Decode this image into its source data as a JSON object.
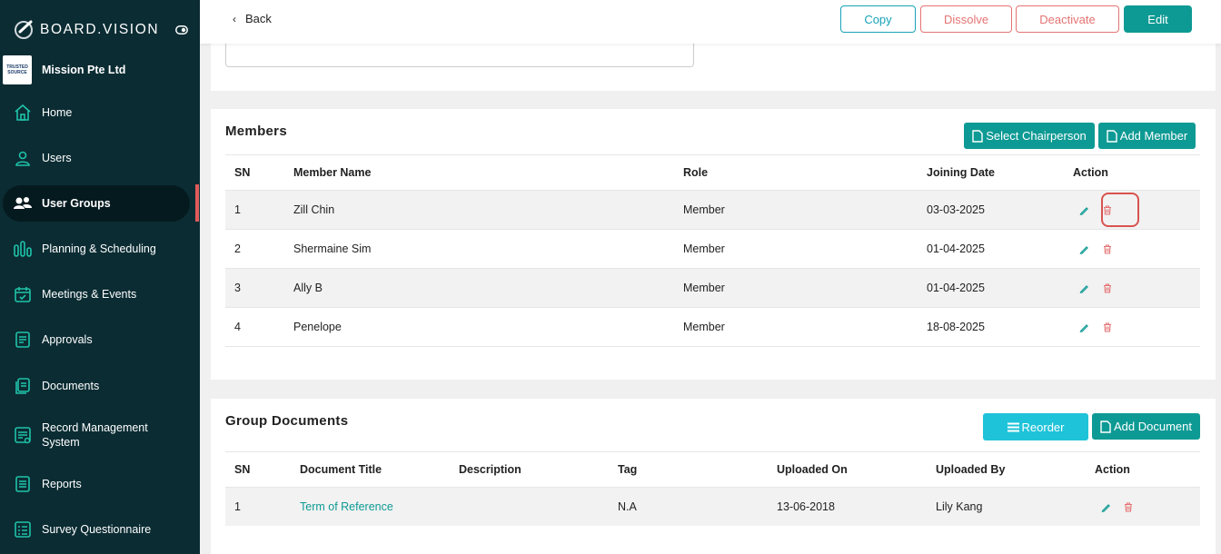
{
  "brand": {
    "name": "BOARD.VISION"
  },
  "organization": {
    "name": "Mission Pte Ltd",
    "logo_text_1": "TRUSTED",
    "logo_text_2": "SOURCE"
  },
  "sidebar": {
    "items": [
      {
        "label": "Home",
        "icon": "home-icon"
      },
      {
        "label": "Users",
        "icon": "user-icon"
      },
      {
        "label": "User Groups",
        "icon": "users-icon",
        "active": true
      },
      {
        "label": "Planning & Scheduling",
        "icon": "bar-chart-icon"
      },
      {
        "label": "Meetings & Events",
        "icon": "calendar-icon"
      },
      {
        "label": "Approvals",
        "icon": "document-icon"
      },
      {
        "label": "Documents",
        "icon": "documents-icon"
      },
      {
        "label": "Record Management System",
        "icon": "records-icon"
      },
      {
        "label": "Reports",
        "icon": "report-icon"
      },
      {
        "label": "Survey Questionnaire",
        "icon": "survey-icon"
      }
    ]
  },
  "header": {
    "back_label": "Back",
    "copy_label": "Copy",
    "dissolve_label": "Dissolve",
    "deactivate_label": "Deactivate",
    "edit_label": "Edit"
  },
  "members": {
    "title": "Members",
    "select_chair_label": "Select Chairperson",
    "add_member_label": "Add Member",
    "columns": [
      "SN",
      "Member Name",
      "Role",
      "Joining Date",
      "Action"
    ],
    "rows": [
      {
        "sn": "1",
        "name": "Zill Chin",
        "role": "Member",
        "date": "03-03-2025"
      },
      {
        "sn": "2",
        "name": "Shermaine Sim",
        "role": "Member",
        "date": "01-04-2025"
      },
      {
        "sn": "3",
        "name": "Ally B",
        "role": "Member",
        "date": "01-04-2025"
      },
      {
        "sn": "4",
        "name": "Penelope",
        "role": "Member",
        "date": "18-08-2025"
      }
    ]
  },
  "documents": {
    "title": "Group Documents",
    "reorder_label": "Reorder",
    "add_document_label": "Add Document",
    "columns": [
      "SN",
      "Document Title",
      "Description",
      "Tag",
      "Uploaded On",
      "Uploaded By",
      "Action"
    ],
    "rows": [
      {
        "sn": "1",
        "title": "Term of Reference",
        "description": "",
        "tag": "N.A",
        "uploaded_on": "13-06-2018",
        "uploaded_by": "Lily Kang"
      }
    ]
  },
  "colors": {
    "sidebar_bg": "#0b2c33",
    "accent": "#0e9a94",
    "danger": "#e57373",
    "cyan": "#1fc3d9"
  }
}
